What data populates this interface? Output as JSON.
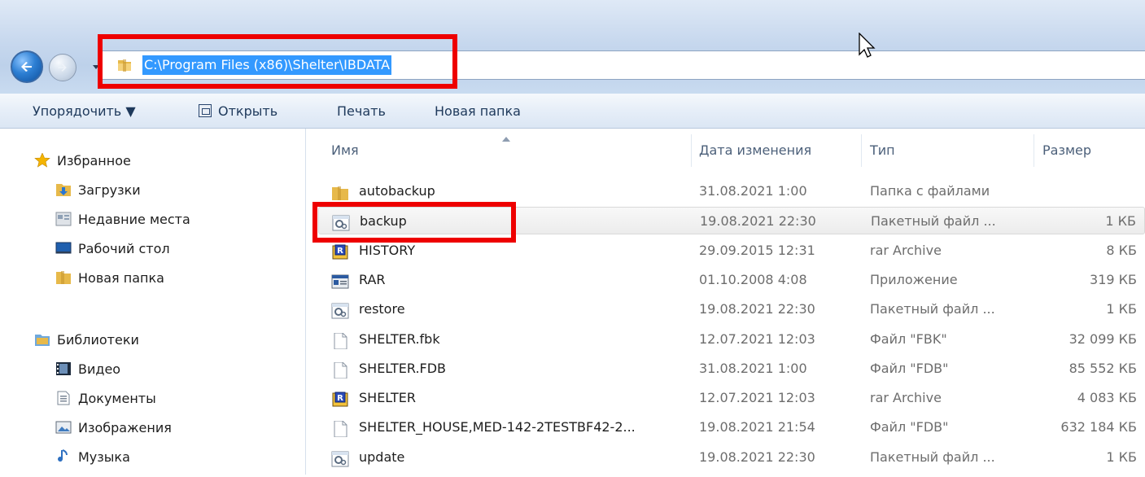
{
  "address": {
    "path": "C:\\Program Files (x86)\\Shelter\\IBDATA"
  },
  "toolbar": {
    "organize": "Упорядочить ▼",
    "open": "Открыть",
    "print": "Печать",
    "new_folder": "Новая папка"
  },
  "nav": {
    "favorites": "Избранное",
    "downloads": "Загрузки",
    "recent": "Недавние места",
    "desktop": "Рабочий стол",
    "new_folder": "Новая папка",
    "libraries": "Библиотеки",
    "video": "Видео",
    "documents": "Документы",
    "pictures": "Изображения",
    "music": "Музыка"
  },
  "columns": {
    "name": "Имя",
    "date": "Дата изменения",
    "type": "Тип",
    "size": "Размер"
  },
  "files": [
    {
      "name": "autobackup",
      "date": "31.08.2021 1:00",
      "type": "Папка с файлами",
      "size": "",
      "icon": "folder-icon"
    },
    {
      "name": "backup",
      "date": "19.08.2021 22:30",
      "type": "Пакетный файл ...",
      "size": "1 КБ",
      "icon": "batch-file-icon"
    },
    {
      "name": "HISTORY",
      "date": "29.09.2015 12:31",
      "type": "rar Archive",
      "size": "8 КБ",
      "icon": "rar-archive-icon"
    },
    {
      "name": "RAR",
      "date": "01.10.2008 4:08",
      "type": "Приложение",
      "size": "319 КБ",
      "icon": "application-icon"
    },
    {
      "name": "restore",
      "date": "19.08.2021 22:30",
      "type": "Пакетный файл ...",
      "size": "1 КБ",
      "icon": "batch-file-icon"
    },
    {
      "name": "SHELTER.fbk",
      "date": "12.07.2021 12:03",
      "type": "Файл \"FBK\"",
      "size": "32 099 КБ",
      "icon": "blank-file-icon"
    },
    {
      "name": "SHELTER.FDB",
      "date": "31.08.2021 1:00",
      "type": "Файл \"FDB\"",
      "size": "85 552 КБ",
      "icon": "blank-file-icon"
    },
    {
      "name": "SHELTER",
      "date": "12.07.2021 12:03",
      "type": "rar Archive",
      "size": "4 083 КБ",
      "icon": "rar-archive-icon"
    },
    {
      "name": "SHELTER_HOUSE,MED-142-2TESTBF42-2...",
      "date": "19.08.2021 21:54",
      "type": "Файл \"FDB\"",
      "size": "632 184 КБ",
      "icon": "blank-file-icon"
    },
    {
      "name": "update",
      "date": "19.08.2021 22:30",
      "type": "Пакетный файл ...",
      "size": "1 КБ",
      "icon": "batch-file-icon"
    }
  ],
  "selected_row": "backup",
  "colors": {
    "highlight": "#ee0000",
    "selection": "#3399ff",
    "accent": "#1e395b"
  }
}
